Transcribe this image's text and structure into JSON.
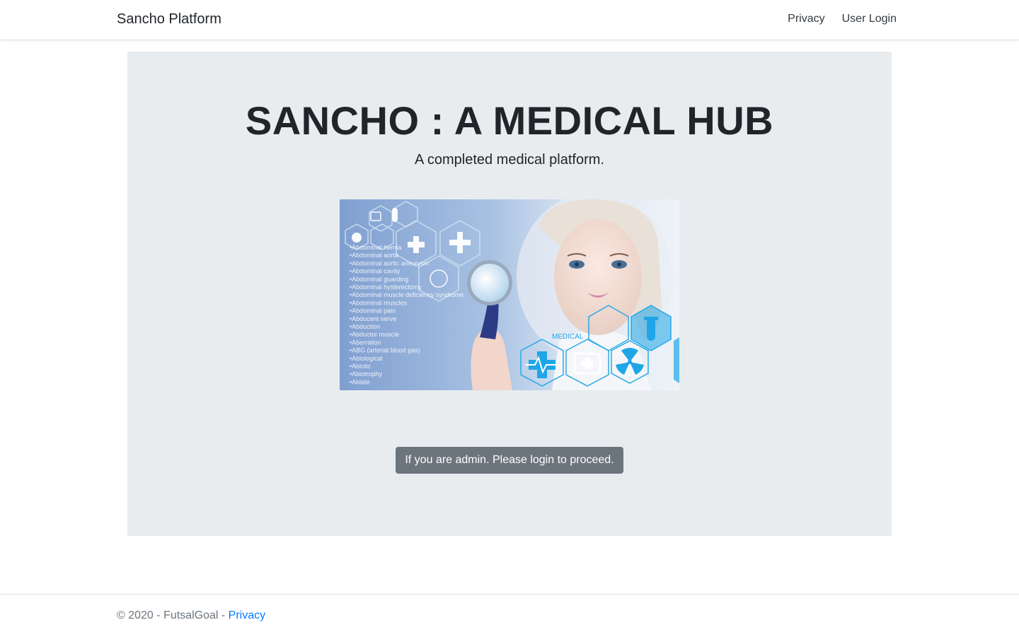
{
  "navbar": {
    "brand": "Sancho Platform",
    "links": [
      "Privacy",
      "User Login"
    ]
  },
  "hero": {
    "title": "SANCHO : A MEDICAL HUB",
    "subtitle": "A completed medical platform.",
    "image": {
      "overlay_label": "MEDICAL",
      "term_list": [
        "•Abdominal hernia",
        "•Abdominal aorta",
        "•Abdominal aortic aneurysm",
        "•Abdominal cavity",
        "•Abdominal guarding",
        "•Abdominal hysterectomy",
        "•Abdominal muscle deficiency syndrome",
        "•Abdominal muscles",
        "•Abdominal pain",
        "•Abducent nerve",
        "•Abduction",
        "•Abductor muscle",
        "•Aberration",
        "•ABG (arterial blood gas)",
        "•Abiological",
        "•Abiotic",
        "•Abiotrophy",
        "•Ablate"
      ]
    },
    "admin_button": "If you are admin. Please login to proceed."
  },
  "footer": {
    "copyright": "© 2020 - FutsalGoal - ",
    "link": "Privacy"
  },
  "colors": {
    "jumbotron_bg": "#e9ecef",
    "button_bg": "#6c757d",
    "link": "#007bff",
    "hex_accent": "#1fa6e8"
  }
}
